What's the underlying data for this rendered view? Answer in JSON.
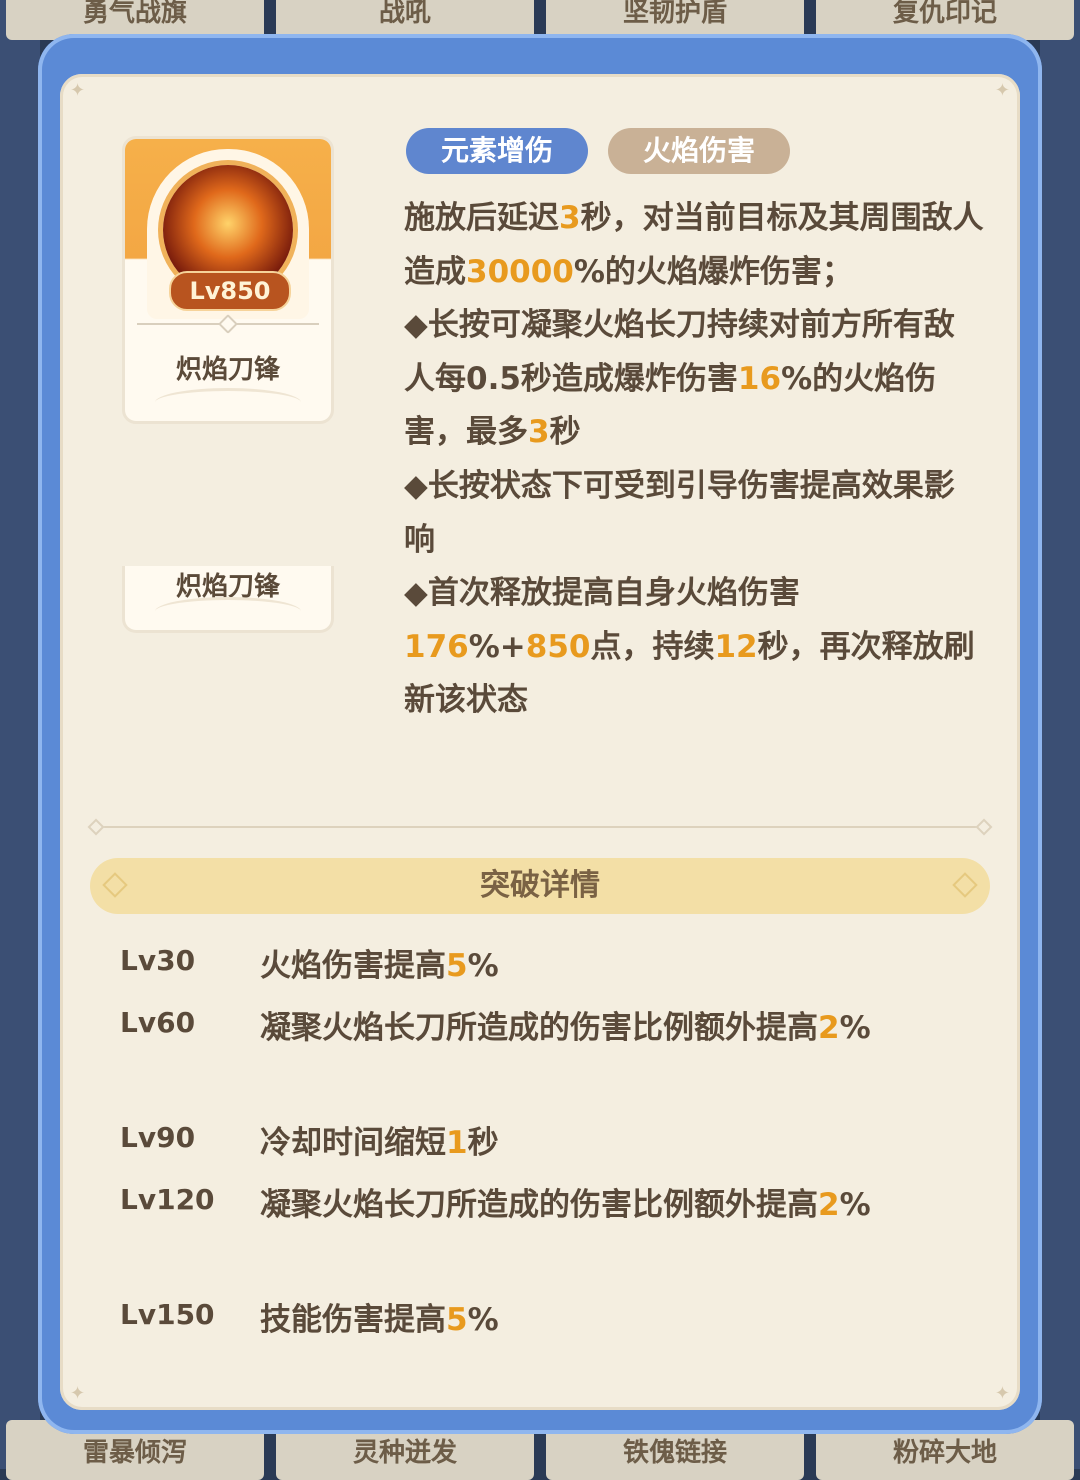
{
  "background": {
    "top_skills": [
      "勇气战旗",
      "战吼",
      "坚韧护盾",
      "复仇印记"
    ],
    "bottom_skills": [
      "雷暴倾泻",
      "灵种迸发",
      "铁傀链接",
      "粉碎大地"
    ]
  },
  "skill": {
    "name": "炽焰刀锋",
    "level": "Lv850",
    "icon": "flame-blade-icon",
    "tags": [
      "元素增伤",
      "火焰伤害"
    ]
  },
  "description": {
    "p1": [
      "施放后延迟",
      "3",
      "秒，对当前目标及其周围敌人造成",
      "30000",
      "%的火焰爆炸伤害；"
    ],
    "p2": [
      "◆长按可凝聚火焰长刀持续对前方所有敌人每0.5秒造成爆炸伤害",
      "16",
      "%的火焰伤害，最多",
      "3",
      "秒"
    ],
    "p3": "◆长按状态下可受到引导伤害提高效果影响",
    "p4": [
      "◆首次释放提高自身火焰伤害",
      "176",
      "%+",
      "850",
      "点，持续",
      "12",
      "秒，再次释放刷新该状态"
    ]
  },
  "breakthrough": {
    "title": "突破详情",
    "rows": [
      {
        "level": "Lv30",
        "text": "火焰伤害提高",
        "value": "5",
        "suffix": "%"
      },
      {
        "level": "Lv60",
        "text": "凝聚火焰长刀所造成的伤害比例额外提高",
        "value": "2",
        "suffix": "%"
      },
      {
        "level": "Lv90",
        "text": "冷却时间缩短",
        "value": "1",
        "suffix": "秒"
      },
      {
        "level": "Lv120",
        "text": "凝聚火焰长刀所造成的伤害比例额外提高",
        "value": "2",
        "suffix": "%"
      },
      {
        "level": "Lv150",
        "text": "技能伤害提高",
        "value": "5",
        "suffix": "%"
      }
    ]
  },
  "colors": {
    "highlight": "#e89a1e",
    "frame": "#5b8ad6",
    "tag_blue": "#5f86cf",
    "tag_tan": "#c9b196"
  }
}
